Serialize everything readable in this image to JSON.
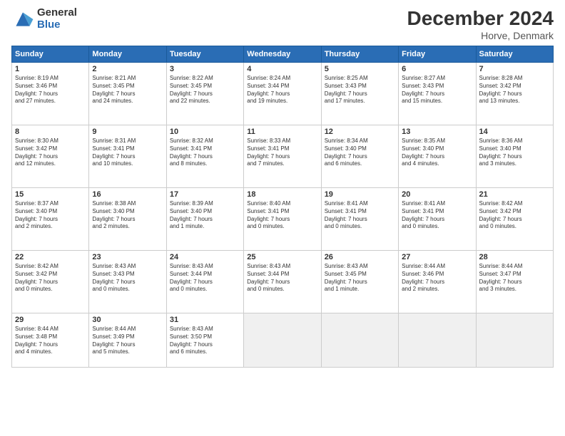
{
  "logo": {
    "general": "General",
    "blue": "Blue"
  },
  "title": "December 2024",
  "location": "Horve, Denmark",
  "days_of_week": [
    "Sunday",
    "Monday",
    "Tuesday",
    "Wednesday",
    "Thursday",
    "Friday",
    "Saturday"
  ],
  "weeks": [
    [
      {
        "day": "1",
        "info": "Sunrise: 8:19 AM\nSunset: 3:46 PM\nDaylight: 7 hours\nand 27 minutes."
      },
      {
        "day": "2",
        "info": "Sunrise: 8:21 AM\nSunset: 3:45 PM\nDaylight: 7 hours\nand 24 minutes."
      },
      {
        "day": "3",
        "info": "Sunrise: 8:22 AM\nSunset: 3:45 PM\nDaylight: 7 hours\nand 22 minutes."
      },
      {
        "day": "4",
        "info": "Sunrise: 8:24 AM\nSunset: 3:44 PM\nDaylight: 7 hours\nand 19 minutes."
      },
      {
        "day": "5",
        "info": "Sunrise: 8:25 AM\nSunset: 3:43 PM\nDaylight: 7 hours\nand 17 minutes."
      },
      {
        "day": "6",
        "info": "Sunrise: 8:27 AM\nSunset: 3:43 PM\nDaylight: 7 hours\nand 15 minutes."
      },
      {
        "day": "7",
        "info": "Sunrise: 8:28 AM\nSunset: 3:42 PM\nDaylight: 7 hours\nand 13 minutes."
      }
    ],
    [
      {
        "day": "8",
        "info": "Sunrise: 8:30 AM\nSunset: 3:42 PM\nDaylight: 7 hours\nand 12 minutes."
      },
      {
        "day": "9",
        "info": "Sunrise: 8:31 AM\nSunset: 3:41 PM\nDaylight: 7 hours\nand 10 minutes."
      },
      {
        "day": "10",
        "info": "Sunrise: 8:32 AM\nSunset: 3:41 PM\nDaylight: 7 hours\nand 8 minutes."
      },
      {
        "day": "11",
        "info": "Sunrise: 8:33 AM\nSunset: 3:41 PM\nDaylight: 7 hours\nand 7 minutes."
      },
      {
        "day": "12",
        "info": "Sunrise: 8:34 AM\nSunset: 3:40 PM\nDaylight: 7 hours\nand 6 minutes."
      },
      {
        "day": "13",
        "info": "Sunrise: 8:35 AM\nSunset: 3:40 PM\nDaylight: 7 hours\nand 4 minutes."
      },
      {
        "day": "14",
        "info": "Sunrise: 8:36 AM\nSunset: 3:40 PM\nDaylight: 7 hours\nand 3 minutes."
      }
    ],
    [
      {
        "day": "15",
        "info": "Sunrise: 8:37 AM\nSunset: 3:40 PM\nDaylight: 7 hours\nand 2 minutes."
      },
      {
        "day": "16",
        "info": "Sunrise: 8:38 AM\nSunset: 3:40 PM\nDaylight: 7 hours\nand 2 minutes."
      },
      {
        "day": "17",
        "info": "Sunrise: 8:39 AM\nSunset: 3:40 PM\nDaylight: 7 hours\nand 1 minute."
      },
      {
        "day": "18",
        "info": "Sunrise: 8:40 AM\nSunset: 3:41 PM\nDaylight: 7 hours\nand 0 minutes."
      },
      {
        "day": "19",
        "info": "Sunrise: 8:41 AM\nSunset: 3:41 PM\nDaylight: 7 hours\nand 0 minutes."
      },
      {
        "day": "20",
        "info": "Sunrise: 8:41 AM\nSunset: 3:41 PM\nDaylight: 7 hours\nand 0 minutes."
      },
      {
        "day": "21",
        "info": "Sunrise: 8:42 AM\nSunset: 3:42 PM\nDaylight: 7 hours\nand 0 minutes."
      }
    ],
    [
      {
        "day": "22",
        "info": "Sunrise: 8:42 AM\nSunset: 3:42 PM\nDaylight: 7 hours\nand 0 minutes."
      },
      {
        "day": "23",
        "info": "Sunrise: 8:43 AM\nSunset: 3:43 PM\nDaylight: 7 hours\nand 0 minutes."
      },
      {
        "day": "24",
        "info": "Sunrise: 8:43 AM\nSunset: 3:44 PM\nDaylight: 7 hours\nand 0 minutes."
      },
      {
        "day": "25",
        "info": "Sunrise: 8:43 AM\nSunset: 3:44 PM\nDaylight: 7 hours\nand 0 minutes."
      },
      {
        "day": "26",
        "info": "Sunrise: 8:43 AM\nSunset: 3:45 PM\nDaylight: 7 hours\nand 1 minute."
      },
      {
        "day": "27",
        "info": "Sunrise: 8:44 AM\nSunset: 3:46 PM\nDaylight: 7 hours\nand 2 minutes."
      },
      {
        "day": "28",
        "info": "Sunrise: 8:44 AM\nSunset: 3:47 PM\nDaylight: 7 hours\nand 3 minutes."
      }
    ],
    [
      {
        "day": "29",
        "info": "Sunrise: 8:44 AM\nSunset: 3:48 PM\nDaylight: 7 hours\nand 4 minutes."
      },
      {
        "day": "30",
        "info": "Sunrise: 8:44 AM\nSunset: 3:49 PM\nDaylight: 7 hours\nand 5 minutes."
      },
      {
        "day": "31",
        "info": "Sunrise: 8:43 AM\nSunset: 3:50 PM\nDaylight: 7 hours\nand 6 minutes."
      },
      null,
      null,
      null,
      null
    ]
  ]
}
